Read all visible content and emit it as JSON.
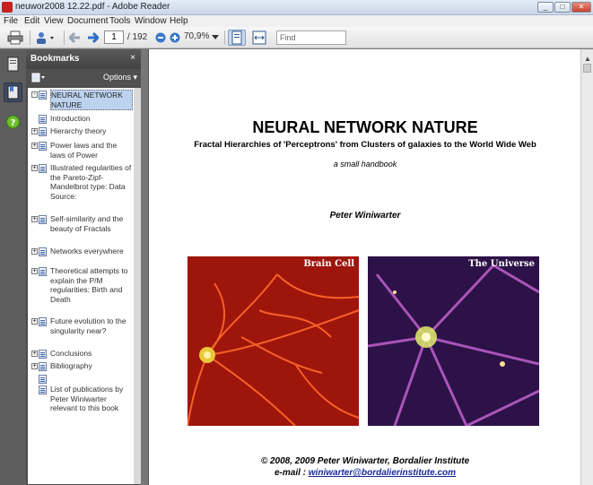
{
  "window": {
    "title": "neuwor2008 12.22.pdf - Adobe Reader",
    "controls": [
      "_",
      "□",
      "✕"
    ]
  },
  "menu": [
    "File",
    "Edit",
    "View",
    "Document",
    "Tools",
    "Window",
    "Help"
  ],
  "toolbar": {
    "current_page": "1",
    "total_pages": "/ 192",
    "zoom": "70,9%",
    "find_placeholder": "Find"
  },
  "bookmarks": {
    "title": "Bookmarks",
    "close": "×",
    "options": "Options ▾",
    "items": [
      {
        "label": "NEURAL NETWORK NATURE",
        "expander": "-",
        "selected": true
      },
      {
        "label": "Introduction",
        "expander": ""
      },
      {
        "label": "Hierarchy theory",
        "expander": "+"
      },
      {
        "label": "Power laws and the laws of Power",
        "expander": "+"
      },
      {
        "label": "Illustrated regularities of the Pareto-Zipf-Mandelbrot type: Data Source:",
        "expander": "+"
      },
      {
        "label": "Self-similarity and the beauty of Fractals",
        "expander": "+"
      },
      {
        "label": "Networks everywhere",
        "expander": "+"
      },
      {
        "label": "Theoretical attempts to explain the P/M regularities: Birth and Death",
        "expander": "+"
      },
      {
        "label": "Future evolution to the singularity near?",
        "expander": "+"
      },
      {
        "label": "Conclusions",
        "expander": "+"
      },
      {
        "label": "Bibliography",
        "expander": "+"
      },
      {
        "label": "",
        "expander": ""
      },
      {
        "label": "List of publications by Peter Winiwarter relevant to this book",
        "expander": ""
      }
    ]
  },
  "document": {
    "title": "NEURAL NETWORK NATURE",
    "subtitle": "Fractal Hierarchies of  'Perceptrons'  from Clusters of galaxies to the World Wide Web",
    "handbook": "a small handbook",
    "author": "Peter Winiwarter",
    "images": [
      {
        "caption": "Brain Cell",
        "color": "#b81c0f"
      },
      {
        "caption": "The Universe",
        "color": "#3d1b5c"
      }
    ],
    "copyright": "©  2008, 2009 Peter Winiwarter, Bordalier Institute",
    "email_prefix": "e-mail : ",
    "email": "winiwarter@bordalierinstitute.com"
  }
}
